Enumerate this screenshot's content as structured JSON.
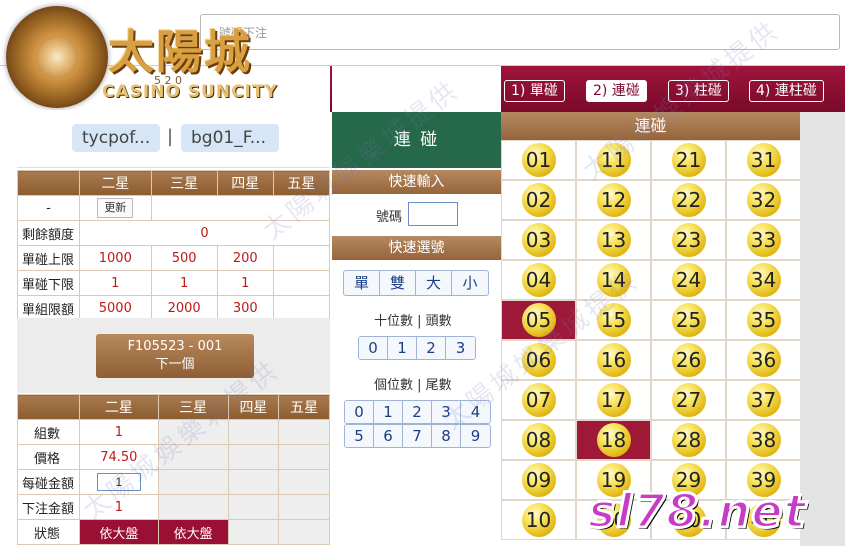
{
  "top_input": {
    "placeholder": "號碼下注"
  },
  "logo": {
    "cn": "太陽城",
    "en": "CASINO SUNCITY",
    "num": "5 2 0"
  },
  "user": {
    "account": "tycpof...",
    "separator": "|",
    "agent": "bg01_F..."
  },
  "nav": {
    "tabs": [
      "1) 單碰",
      "2) 連碰",
      "3) 柱碰",
      "4) 連柱碰"
    ],
    "active": 1
  },
  "limits_table": {
    "headers": [
      "",
      "二星",
      "三星",
      "四星",
      "五星"
    ],
    "refresh_row": {
      "label": "-",
      "button": "更新"
    },
    "remaining": {
      "label": "剩餘額度",
      "value": "0"
    },
    "rows": [
      {
        "label": "單碰上限",
        "values": [
          "1000",
          "500",
          "200",
          ""
        ]
      },
      {
        "label": "單碰下限",
        "values": [
          "1",
          "1",
          "1",
          ""
        ]
      },
      {
        "label": "單組限額",
        "values": [
          "5000",
          "2000",
          "300",
          ""
        ]
      }
    ]
  },
  "next_button": {
    "line1": "F105523 - 001",
    "line2": "下一個"
  },
  "bet_table": {
    "headers": [
      "",
      "二星",
      "三星",
      "四星",
      "五星"
    ],
    "groups": {
      "label": "組數",
      "value": "1"
    },
    "price": {
      "label": "價格",
      "value": "74.50"
    },
    "per_amount": {
      "label": "每碰金額",
      "value": "1"
    },
    "total": {
      "label": "下注金額",
      "value": "1"
    },
    "status": {
      "label": "狀態",
      "values": [
        "依大盤",
        "依大盤"
      ]
    }
  },
  "middle": {
    "title": "連 碰",
    "quick_input": "快速輸入",
    "number_label": "號碼",
    "quick_select": "快速選號",
    "quick_buttons": [
      "單",
      "雙",
      "大",
      "小"
    ],
    "tens_label": "十位數 | 頭數",
    "tens_buttons": [
      "0",
      "1",
      "2",
      "3"
    ],
    "units_label": "個位數 | 尾數",
    "units_row1": [
      "0",
      "1",
      "2",
      "3",
      "4"
    ],
    "units_row2": [
      "5",
      "6",
      "7",
      "8",
      "9"
    ]
  },
  "grid": {
    "title": "連碰",
    "numbers": [
      "01",
      "11",
      "21",
      "31",
      "02",
      "12",
      "22",
      "32",
      "03",
      "13",
      "23",
      "33",
      "04",
      "14",
      "24",
      "34",
      "05",
      "15",
      "25",
      "35",
      "06",
      "16",
      "26",
      "36",
      "07",
      "17",
      "27",
      "37",
      "08",
      "18",
      "28",
      "38",
      "09",
      "19",
      "29",
      "39",
      "10",
      "20",
      "30",
      "40"
    ],
    "selected": [
      "05",
      "18"
    ]
  },
  "watermark": "太陽城娛樂城提供",
  "site": "sl78.net",
  "colors": {
    "nav": "#8a0e32",
    "band": "#a67648",
    "green_head": "#25684a",
    "selected": "#9e1838",
    "ball": "#f3d84a"
  }
}
